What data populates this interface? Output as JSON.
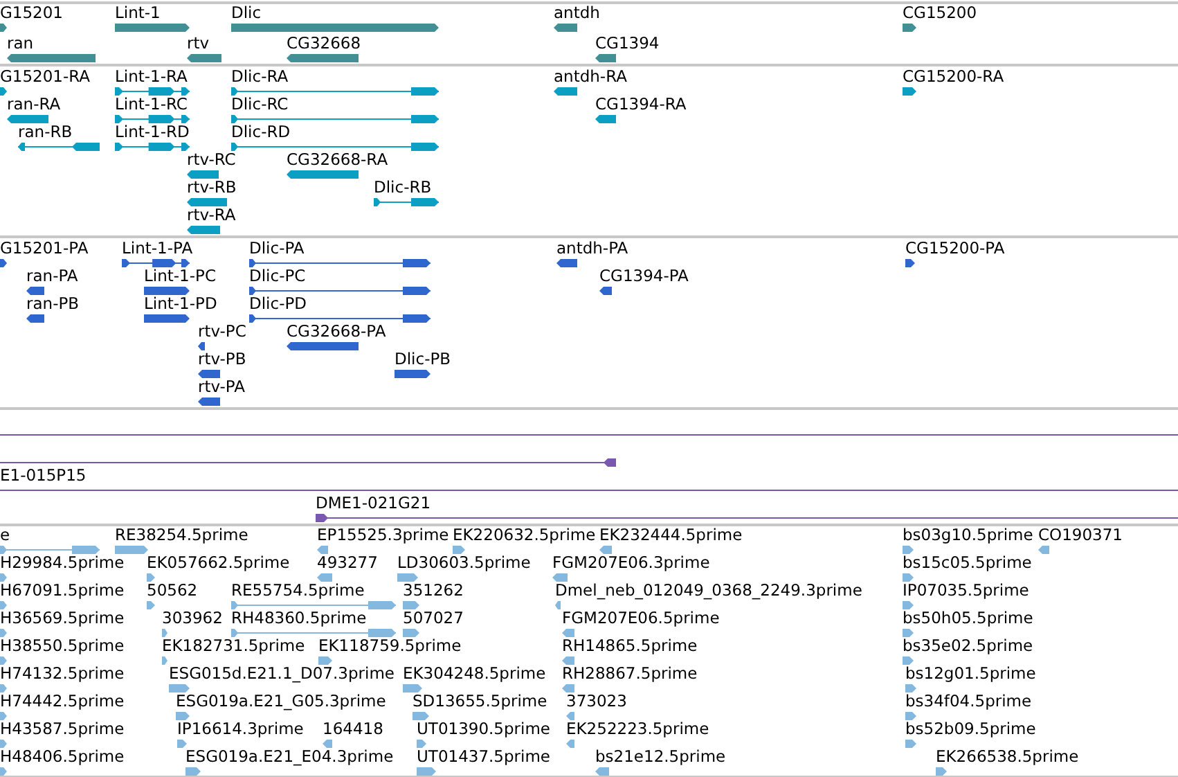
{
  "tracks": [
    {
      "kind": "gene",
      "features": [
        {
          "label": "G15201",
          "forward": true
        },
        {
          "label": "Lint-1",
          "forward": true
        },
        {
          "label": "Dlic",
          "forward": true
        },
        {
          "label": "antdh",
          "forward": false
        },
        {
          "label": "CG15200",
          "forward": true
        },
        {
          "label": "ran",
          "forward": false
        },
        {
          "label": "rtv",
          "forward": false
        },
        {
          "label": "CG32668",
          "forward": false
        },
        {
          "label": "CG1394",
          "forward": false
        }
      ]
    },
    {
      "kind": "transcript",
      "features": [
        {
          "label": "G15201-RA",
          "forward": true
        },
        {
          "label": "Lint-1-RA",
          "forward": true
        },
        {
          "label": "Dlic-RA",
          "forward": true
        },
        {
          "label": "antdh-RA",
          "forward": false
        },
        {
          "label": "CG15200-RA",
          "forward": true
        },
        {
          "label": "ran-RA",
          "forward": false
        },
        {
          "label": "Lint-1-RC",
          "forward": true
        },
        {
          "label": "Dlic-RC",
          "forward": true
        },
        {
          "label": "CG1394-RA",
          "forward": false
        },
        {
          "label": "ran-RB",
          "forward": false
        },
        {
          "label": "Lint-1-RD",
          "forward": true
        },
        {
          "label": "Dlic-RD",
          "forward": true
        },
        {
          "label": "rtv-RC",
          "forward": false
        },
        {
          "label": "CG32668-RA",
          "forward": false
        },
        {
          "label": "rtv-RB",
          "forward": false
        },
        {
          "label": "Dlic-RB",
          "forward": true
        },
        {
          "label": "rtv-RA",
          "forward": false
        }
      ]
    },
    {
      "kind": "protein",
      "features": [
        {
          "label": "G15201-PA",
          "forward": true
        },
        {
          "label": "Lint-1-PA",
          "forward": true
        },
        {
          "label": "Dlic-PA",
          "forward": true
        },
        {
          "label": "antdh-PA",
          "forward": false
        },
        {
          "label": "CG15200-PA",
          "forward": true
        },
        {
          "label": "ran-PA",
          "forward": false
        },
        {
          "label": "Lint-1-PC",
          "forward": true
        },
        {
          "label": "Dlic-PC",
          "forward": true
        },
        {
          "label": "CG1394-PA",
          "forward": false
        },
        {
          "label": "ran-PB",
          "forward": false
        },
        {
          "label": "Lint-1-PD",
          "forward": true
        },
        {
          "label": "Dlic-PD",
          "forward": true
        },
        {
          "label": "rtv-PC",
          "forward": false
        },
        {
          "label": "CG32668-PA",
          "forward": false
        },
        {
          "label": "rtv-PB",
          "forward": false
        },
        {
          "label": "Dlic-PB",
          "forward": true
        },
        {
          "label": "rtv-PA",
          "forward": false
        }
      ]
    },
    {
      "kind": "clone",
      "features": [
        {
          "kind": "line"
        },
        {
          "kind": "capped",
          "forward": false
        },
        {
          "kind": "line",
          "label": "E1-015P15"
        },
        {
          "kind": "capped",
          "label": "DME1-021G21",
          "forward": true
        }
      ]
    },
    {
      "kind": "est",
      "features": [
        {
          "label": "e",
          "forward": true
        },
        {
          "label": "RE38254.5prime",
          "forward": true
        },
        {
          "label": "EP15525.3prime",
          "forward": false
        },
        {
          "label": "EK220632.5prime",
          "forward": true
        },
        {
          "label": "EK232444.5prime",
          "forward": false
        },
        {
          "label": "bs03g10.5prime",
          "forward": true
        },
        {
          "label": "CO190371",
          "forward": false
        },
        {
          "label": "H29984.5prime",
          "forward": true
        },
        {
          "label": "EK057662.5prime",
          "forward": true
        },
        {
          "label": "493277",
          "forward": false
        },
        {
          "label": "LD30603.5prime",
          "forward": true
        },
        {
          "label": "FGM207E06.3prime",
          "forward": false
        },
        {
          "label": "bs15c05.5prime",
          "forward": true
        },
        {
          "label": "H67091.5prime",
          "forward": true
        },
        {
          "label": "50562",
          "forward": true
        },
        {
          "label": "RE55754.5prime",
          "forward": true
        },
        {
          "label": "351262",
          "forward": true
        },
        {
          "label": "Dmel_neb_012049_0368_2249.3prime",
          "forward": false
        },
        {
          "label": "IP07035.5prime",
          "forward": true
        },
        {
          "label": "H36569.5prime",
          "forward": true
        },
        {
          "label": "303962",
          "forward": true
        },
        {
          "label": "RH48360.5prime",
          "forward": true
        },
        {
          "label": "507027",
          "forward": true
        },
        {
          "label": "FGM207E06.5prime",
          "forward": false
        },
        {
          "label": "bs50h05.5prime",
          "forward": true
        },
        {
          "label": "H38550.5prime",
          "forward": true
        },
        {
          "label": "EK182731.5prime",
          "forward": true
        },
        {
          "label": "EK118759.5prime",
          "forward": true
        },
        {
          "label": "RH14865.5prime",
          "forward": false
        },
        {
          "label": "bs35e02.5prime",
          "forward": true
        },
        {
          "label": "H74132.5prime",
          "forward": true
        },
        {
          "label": "ESG015d.E21.1_D07.3prime",
          "forward": true
        },
        {
          "label": "EK304248.5prime",
          "forward": true
        },
        {
          "label": "RH28867.5prime",
          "forward": false
        },
        {
          "label": "bs12g01.5prime",
          "forward": true
        },
        {
          "label": "H74442.5prime",
          "forward": true
        },
        {
          "label": "ESG019a.E21_G05.3prime",
          "forward": true
        },
        {
          "label": "SD13655.5prime",
          "forward": true
        },
        {
          "label": "373023",
          "forward": false
        },
        {
          "label": "bs34f04.5prime",
          "forward": true
        },
        {
          "label": "H43587.5prime",
          "forward": true
        },
        {
          "label": "IP16614.3prime",
          "forward": true
        },
        {
          "label": "164418",
          "forward": false
        },
        {
          "label": "UT01390.5prime",
          "forward": true
        },
        {
          "label": "EK252223.5prime",
          "forward": false
        },
        {
          "label": "bs52b09.5prime",
          "forward": true
        },
        {
          "label": "H48406.5prime",
          "forward": true
        },
        {
          "label": "ESG019a.E21_E04.3prime",
          "forward": true
        },
        {
          "label": "UT01437.5prime",
          "forward": true
        },
        {
          "label": "bs21e12.5prime",
          "forward": false
        },
        {
          "label": "EK266538.5prime",
          "forward": true
        }
      ]
    }
  ]
}
